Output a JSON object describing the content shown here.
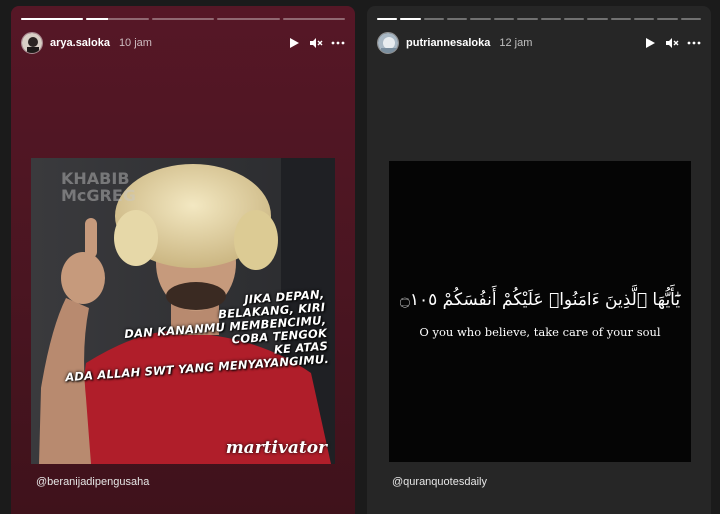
{
  "stories": [
    {
      "username": "arya.saloka",
      "time": "10 jam",
      "progress_segments": [
        1,
        0.35,
        0,
        0,
        0
      ],
      "image": {
        "background_letters": [
          "KHABIB",
          "McGREG"
        ],
        "quote_lines": [
          "JIKA DEPAN,",
          "BELAKANG, KIRI",
          "DAN KANANMU MEMBENCIMU,",
          "COBA TENGOK",
          "KE ATAS",
          "ADA ALLAH SWT YANG MENYAYANGIMU."
        ],
        "signature": "martivator"
      },
      "mention": "@beranijadipengusaha",
      "colors": {
        "background": "#561726",
        "shirt": "#b01e2a",
        "hat": "#e8d9a6"
      }
    },
    {
      "username": "putriannesaloka",
      "time": "12 jam",
      "progress_segments": [
        1,
        1,
        0,
        0,
        0,
        0,
        0,
        0,
        0,
        0,
        0,
        0,
        0,
        0
      ],
      "image": {
        "arabic": "يَٰٓأَيُّهَا ٱلَّذِينَ ءَامَنُوا۟ عَلَيْكُمْ أَنفُسَكُمْ ۝١٠٥",
        "translation": "O you who believe, take care of your soul"
      },
      "mention": "@quranquotesdaily",
      "colors": {
        "background": "#262626"
      }
    }
  ],
  "icons": [
    "play-icon",
    "mute-icon",
    "more-icon"
  ]
}
